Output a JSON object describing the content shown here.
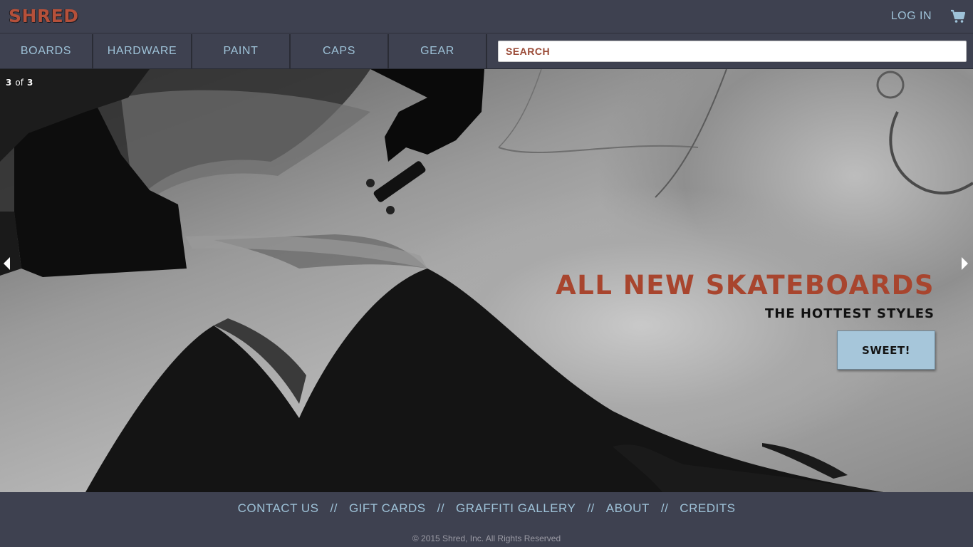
{
  "header": {
    "logo": "SHRED",
    "login_label": "LOG IN",
    "cart_icon": "shopping-cart-icon"
  },
  "nav": {
    "items": [
      {
        "label": "BOARDS"
      },
      {
        "label": "HARDWARE"
      },
      {
        "label": "PAINT"
      },
      {
        "label": "CAPS"
      },
      {
        "label": "GEAR"
      }
    ],
    "search_placeholder": "SEARCH"
  },
  "hero": {
    "slide_current": "3",
    "slide_of": "of",
    "slide_total": "3",
    "title": "ALL NEW SKATEBOARDS",
    "subtitle": "THE HOTTEST STYLES",
    "cta_label": "SWEET!",
    "prev_icon": "chevron-left-icon",
    "next_icon": "chevron-right-icon"
  },
  "footer": {
    "links": [
      {
        "label": "CONTACT US"
      },
      {
        "label": "GIFT CARDS"
      },
      {
        "label": "GRAFFITI GALLERY"
      },
      {
        "label": "ABOUT"
      },
      {
        "label": "CREDITS"
      }
    ],
    "separator": "//",
    "copyright": "© 2015 Shred, Inc. All Rights Reserved"
  },
  "colors": {
    "bar_background": "#3e4150",
    "link_blue": "#9ec2d8",
    "accent_rust": "#a8452e",
    "cta_background": "#a6c6da"
  }
}
